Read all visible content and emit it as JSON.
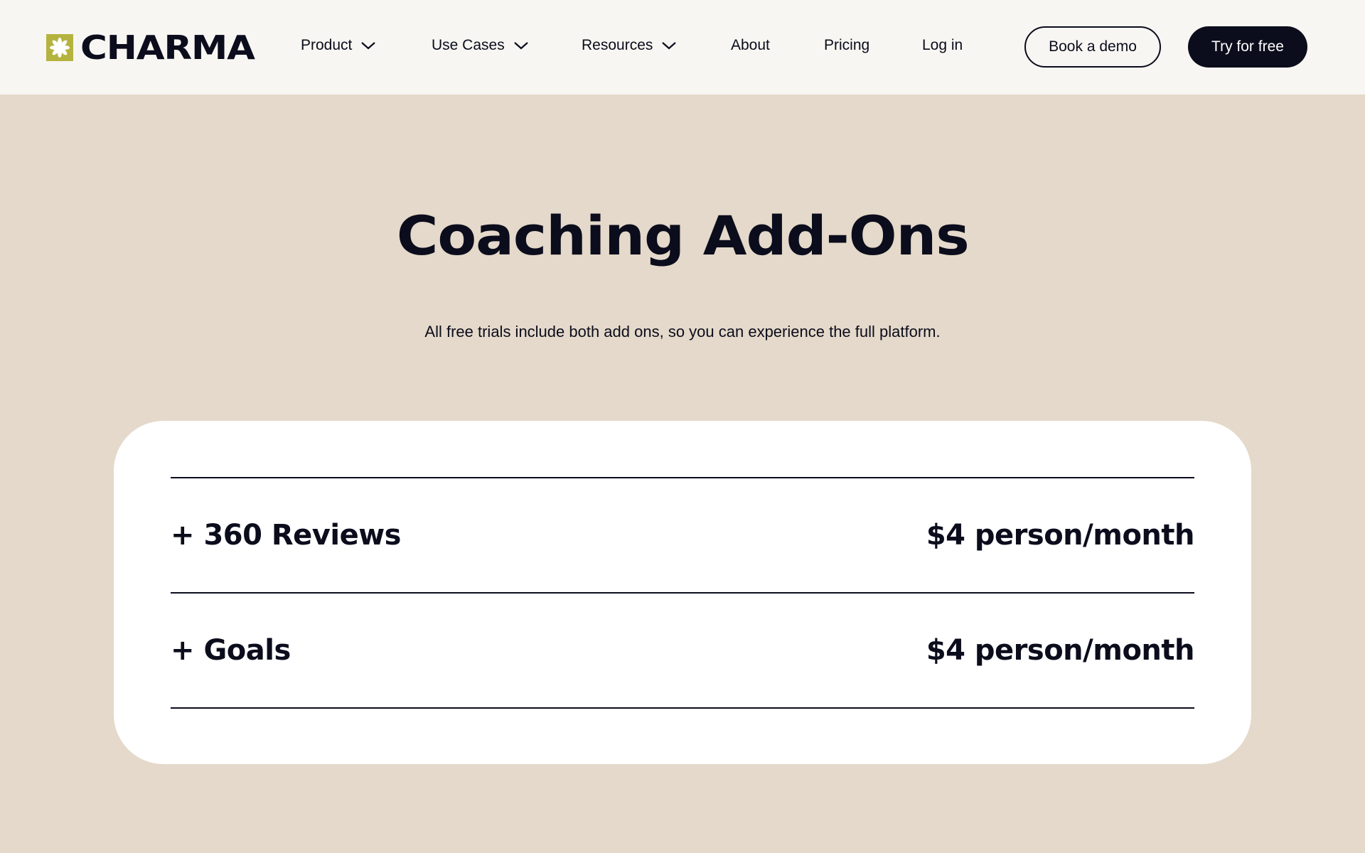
{
  "brand": {
    "name": "CHARMA",
    "logo_color": "#b5b33f"
  },
  "nav": {
    "items": [
      {
        "label": "Product",
        "has_dropdown": true
      },
      {
        "label": "Use Cases",
        "has_dropdown": true
      },
      {
        "label": "Resources",
        "has_dropdown": true
      },
      {
        "label": "About",
        "has_dropdown": false
      },
      {
        "label": "Pricing",
        "has_dropdown": false
      },
      {
        "label": "Log in",
        "has_dropdown": false
      }
    ],
    "book_demo_label": "Book a demo",
    "try_free_label": "Try for free"
  },
  "hero": {
    "title": "Coaching Add-Ons",
    "subtitle": "All free trials include both add ons, so you can experience the full platform."
  },
  "addons": [
    {
      "name": "+ 360 Reviews",
      "price": "$4 person/month"
    },
    {
      "name": "+ Goals",
      "price": "$4 person/month"
    }
  ],
  "colors": {
    "page_bg": "#e4d9ca",
    "header_bg": "#f7f6f2",
    "text": "#0b0c1c",
    "card_bg": "#ffffff"
  }
}
